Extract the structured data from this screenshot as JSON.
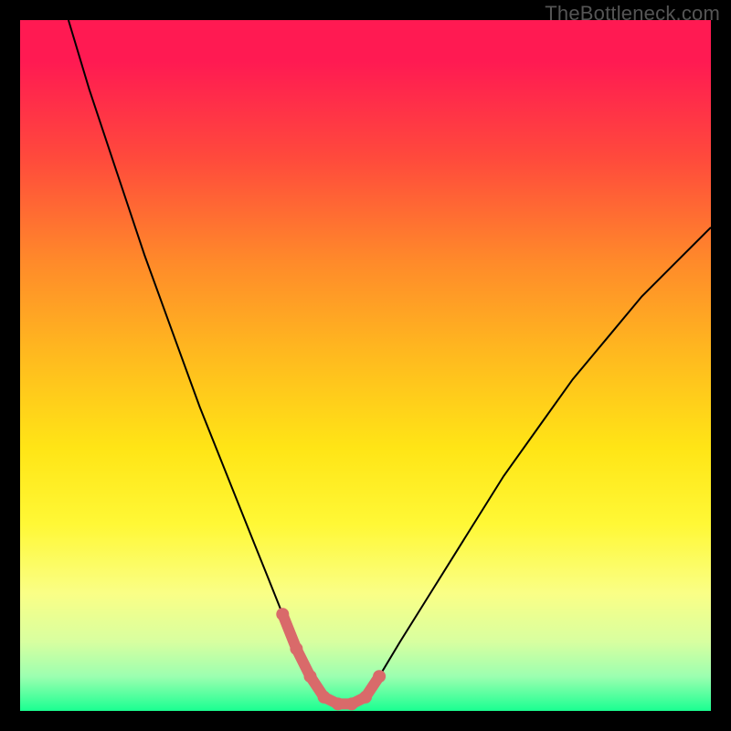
{
  "watermark": "TheBottleneck.com",
  "colors": {
    "curve": "#000000",
    "highlight": "#d96a6a",
    "gradient_top": "#ff1a52",
    "gradient_bottom": "#1aff91"
  },
  "chart_data": {
    "type": "line",
    "title": "",
    "xlabel": "",
    "ylabel": "",
    "xlim": [
      0,
      100
    ],
    "ylim": [
      0,
      100
    ],
    "grid": false,
    "series": [
      {
        "name": "bottleneck-curve",
        "x": [
          7,
          10,
          14,
          18,
          22,
          26,
          30,
          34,
          36,
          38,
          40,
          42,
          44,
          46,
          48,
          50,
          52,
          55,
          60,
          65,
          70,
          75,
          80,
          85,
          90,
          95,
          100
        ],
        "y": [
          100,
          90,
          78,
          66,
          55,
          44,
          34,
          24,
          19,
          14,
          9,
          5,
          2,
          1,
          1,
          2,
          5,
          10,
          18,
          26,
          34,
          41,
          48,
          54,
          60,
          65,
          70
        ]
      }
    ],
    "highlight": {
      "name": "optimal-zone",
      "x": [
        38,
        40,
        42,
        44,
        46,
        48,
        50,
        52
      ],
      "y": [
        14,
        9,
        5,
        2,
        1,
        1,
        2,
        5
      ],
      "color": "#d96a6a"
    },
    "annotations": []
  }
}
